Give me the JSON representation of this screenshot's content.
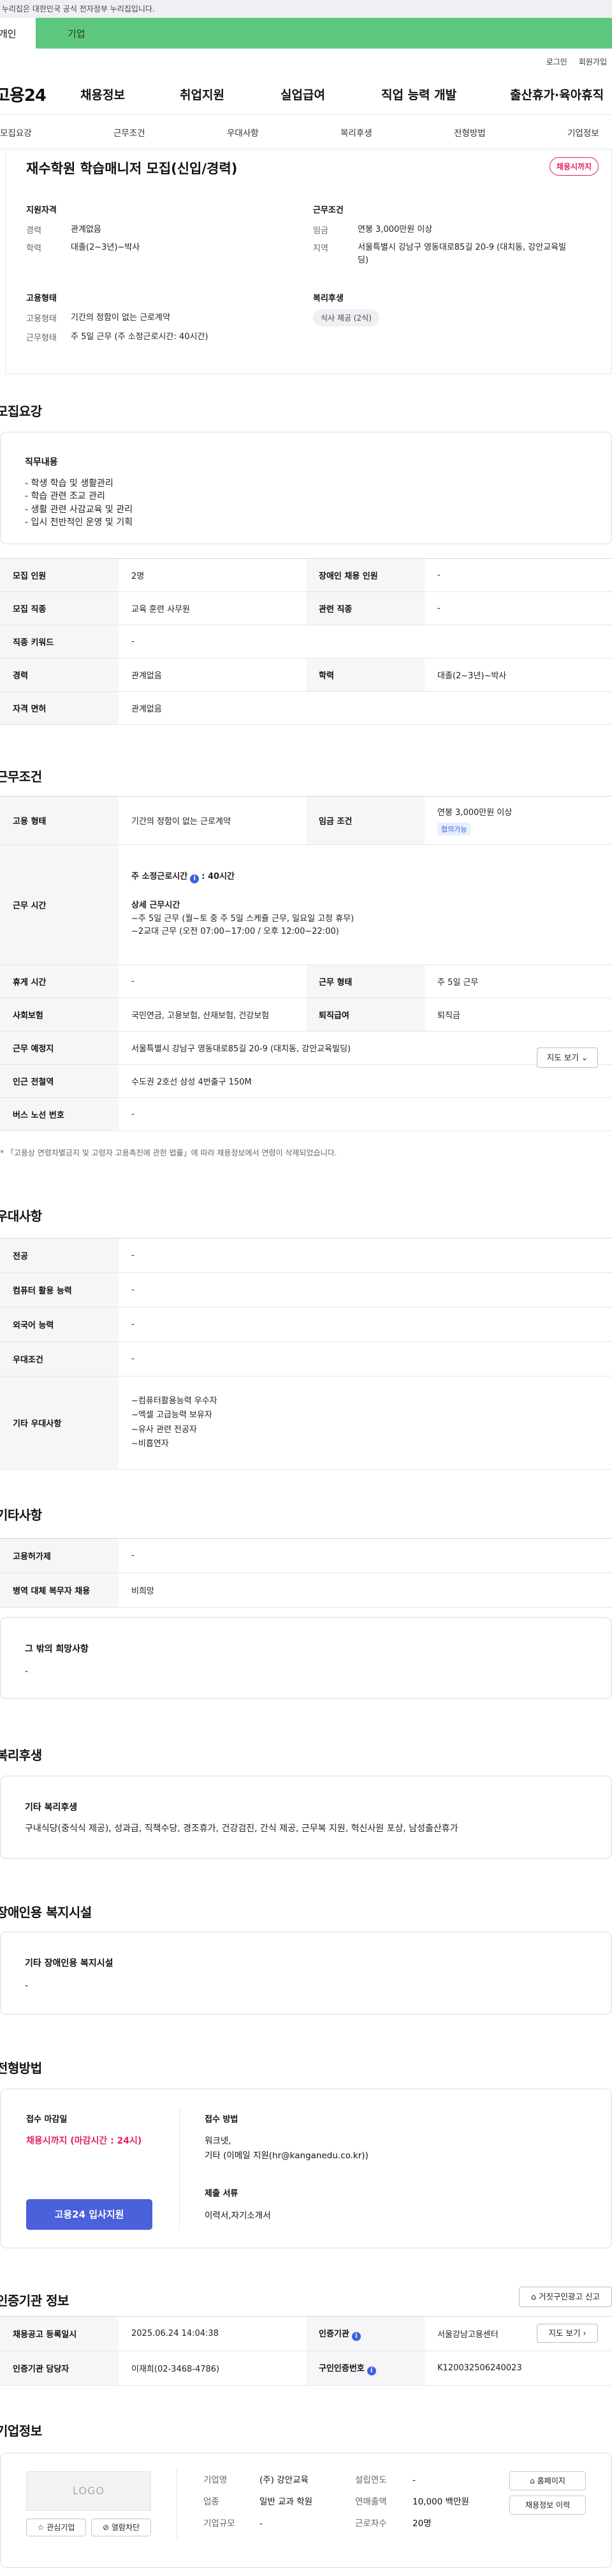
{
  "gov_banner": "이 누리집은 대한민국 공식 전자정부 누리집입니다.",
  "tabs": {
    "personal": "개인",
    "company": "기업"
  },
  "util": {
    "login": "로그인",
    "signup": "회원가입"
  },
  "gnb": {
    "logo": "고용24",
    "items": [
      "채용정보",
      "취업지원",
      "실업급여",
      "직업 능력 개발",
      "출산휴가·육아휴직"
    ]
  },
  "anchors": [
    "모집요강",
    "근무조건",
    "우대사항",
    "복리후생",
    "전형방법",
    "기업정보"
  ],
  "summary": {
    "title": "재수학원 학습매니저 모집(신입/경력)",
    "badge": "채용시까지",
    "qual_head": "지원자격",
    "career_k": "경력",
    "career_v": "관계없음",
    "edu_k": "학력",
    "edu_v": "대졸(2~3년)~박사",
    "cond_head": "근무조건",
    "wage_k": "임금",
    "wage_v": "연봉 3,000만원 이상",
    "region_k": "지역",
    "region_v": "서울특별시 강남구 영동대로85길 20-9 (대치동, 강안교육빌딩)",
    "emp_head": "고용형태",
    "emp_k": "고용형태",
    "emp_v": "기간의 정함이 없는 근로계약",
    "worktype_k": "근무형태",
    "worktype_v": "주 5일 근무 (주 소정근로시간: 40시간)",
    "welfare_head": "복리후생",
    "welfare_pill": "식사 제공 (2식)"
  },
  "recruit": {
    "section_title": "모집요강",
    "duty_title": "직무내용",
    "duty_lines": [
      "- 학생 학습 및 생활관리",
      "- 학습 관련 조교 관리",
      "- 생활 관련 사감교육 및 관리",
      "- 입시 전반적인 운영 및 기획"
    ],
    "rows": {
      "headcount_k": "모집 인원",
      "headcount_v": "2명",
      "disabled_k": "장애인 채용 인원",
      "disabled_v": "-",
      "job_k": "모집 직종",
      "job_v": "교육 훈련 사무원",
      "related_k": "관련 직종",
      "related_v": "-",
      "keyword_k": "직종 키워드",
      "keyword_v": "-",
      "career_k": "경력",
      "career_v": "관계없음",
      "edu_k": "학력",
      "edu_v": "대졸(2~3년)~박사",
      "license_k": "자격 면허",
      "license_v": "관계없음"
    }
  },
  "conditions": {
    "section_title": "근무조건",
    "emp_k": "고용 형태",
    "emp_v": "기간의 정함이 없는 근로계약",
    "wage_k": "임금 조건",
    "wage_v": "연봉 3,000만원 이상",
    "wage_tag": "협의가능",
    "hours_k": "근무 시간",
    "hours_weekly_label": "주 소정근로시간",
    "hours_weekly_v": ": 40시간",
    "hours_detail_title": "상세 근무시간",
    "hours_detail_1": "~주 5일 근무 (월~토 중 주 5일 스케쥴 근무, 일요일 고정 휴무)",
    "hours_detail_2": "~2교대 근무 (오전 07:00~17:00 / 오후 12:00~22:00)",
    "break_k": "휴게 시간",
    "break_v": "-",
    "worktype_k": "근무 형태",
    "worktype_v": "주 5일 근무",
    "insurance_k": "사회보험",
    "insurance_v": "국민연금, 고용보험, 산재보험, 건강보험",
    "retire_k": "퇴직급여",
    "retire_v": "퇴직금",
    "place_k": "근무 예정지",
    "place_v": "서울특별시 강남구 영동대로85길 20-9 (대치동, 강안교육빌딩)",
    "map_btn": "지도 보기",
    "subway_k": "인근 전철역",
    "subway_v": "수도권 2호선 삼성 4번출구 150M",
    "bus_k": "버스 노선 번호",
    "bus_v": "-",
    "notice": "* 「고용상 연령차별금지 및 고령자 고용촉진에 관한 법률」에 따라 채용정보에서 연령이 삭제되었습니다."
  },
  "preferences": {
    "section_title": "우대사항",
    "major_k": "전공",
    "major_v": "-",
    "computer_k": "컴퓨터 활용 능력",
    "computer_v": "-",
    "lang_k": "외국어 능력",
    "lang_v": "-",
    "pref_k": "우대조건",
    "pref_v": "-",
    "etc_k": "기타 우대사항",
    "etc_lines": [
      "~컴퓨터활용능력 우수자",
      "~엑셀 고급능력 보유자",
      "~유사 관련 전공자",
      "~비흡연자"
    ]
  },
  "others": {
    "section_title": "기타사항",
    "hire_k": "고용허가제",
    "hire_v": "-",
    "military_k": "병역 대체 복무자 채용",
    "military_v": "비희망",
    "extra_title": "그 밖의 희망사항",
    "extra_v": "-"
  },
  "welfare": {
    "section_title": "복리후생",
    "card_title": "기타 복리후생",
    "card_text": "구내식당(중식식 제공), 성과급, 직책수당, 경조휴가, 건강검진, 간식 제공, 근무복 지원, 혁신사원 포상, 남성출산휴가"
  },
  "disability": {
    "section_title": "장애인용 복지시설",
    "card_title": "기타 장애인용 복지시설",
    "card_text": "-"
  },
  "process": {
    "section_title": "전형방법",
    "deadline_label": "접수 마감일",
    "deadline_v": "채용시까지 (마감시간 : 24시)",
    "method_label": "접수 방법",
    "method_lines": [
      "워크넷,",
      "기타 (이메일 지원(hr@kanganedu.co.kr))"
    ],
    "docs_label": "제출 서류",
    "docs_v": "이력서,자기소개서",
    "apply_btn": "고용24 입사지원"
  },
  "agency": {
    "section_title": "인증기관 정보",
    "report_btn": "거짓구인광고 신고",
    "reg_k": "채용공고 등록일시",
    "reg_v": "2025.06.24 14:04:38",
    "org_k": "인증기관",
    "org_v": "서울강남고용센터",
    "map_btn": "지도 보기",
    "manager_k": "인증기관 담당자",
    "manager_v": "이재희(02-3468-4786)",
    "cert_k": "구인인증번호",
    "cert_v": "K120032506240023"
  },
  "company": {
    "section_title": "기업정보",
    "logo_text": "LOGO",
    "interest_btn": "관심기업",
    "block_btn": "열람차단",
    "name_k": "기업명",
    "name_v": "(주) 강안교육",
    "year_k": "설립연도",
    "year_v": "-",
    "industry_k": "업종",
    "industry_v": "일반 교과 학원",
    "revenue_k": "연매출액",
    "revenue_v": "10,000 백만원",
    "size_k": "기업규모",
    "size_v": "-",
    "employees_k": "근로자수",
    "employees_v": "20명",
    "home_btn": "홈페이지",
    "jobs_btn": "채용정보 이력"
  }
}
